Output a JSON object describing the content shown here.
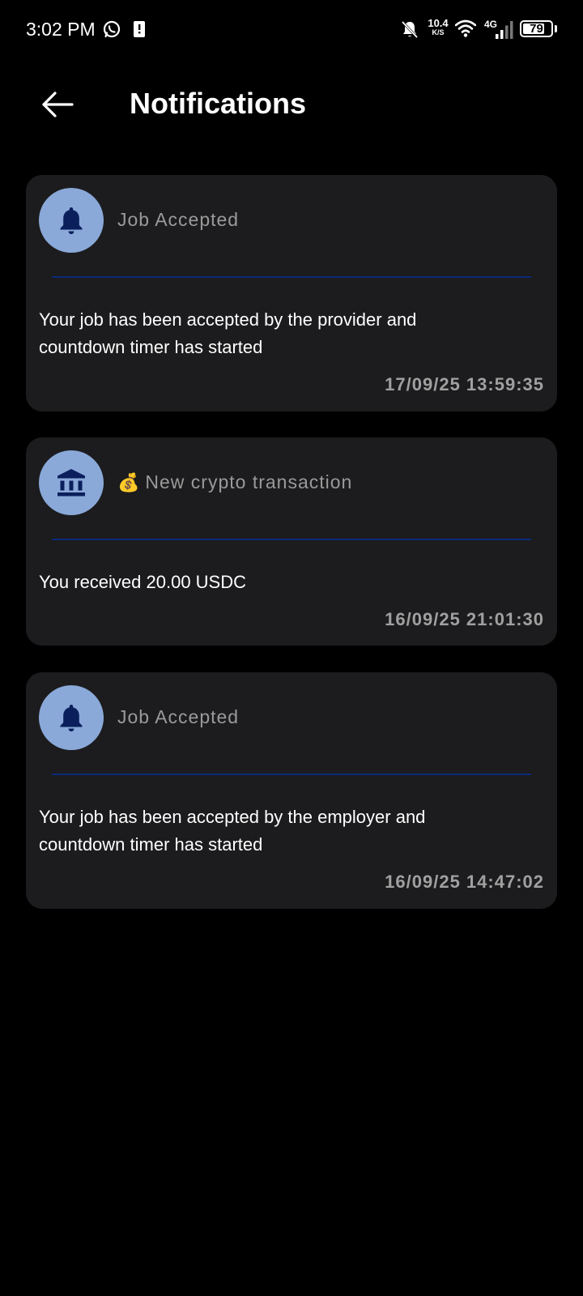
{
  "status_bar": {
    "time": "3:02 PM",
    "net_speed": "10.4",
    "net_speed_unit": "K/S",
    "network_type": "4G",
    "battery_level": "79",
    "icons": [
      "whatsapp-icon",
      "sim-alert-icon",
      "mute-bell-icon",
      "wifi-icon",
      "signal-icon",
      "battery-icon"
    ]
  },
  "app_bar": {
    "title": "Notifications",
    "back_icon": "arrow-left-icon"
  },
  "notifications": [
    {
      "icon": "bell-icon",
      "title": "Job Accepted",
      "body": "Your job has been accepted by the provider and countdown timer has started",
      "timestamp": "17/09/25 13:59:35"
    },
    {
      "icon": "bank-icon",
      "emoji": "💰",
      "title": "New crypto transaction",
      "body": "You received 20.00 USDC",
      "timestamp": "16/09/25 21:01:30"
    },
    {
      "icon": "bell-icon",
      "title": "Job Accepted",
      "body": "Your job has been accepted by the employer and countdown timer has started",
      "timestamp": "16/09/25 14:47:02"
    }
  ],
  "colors": {
    "background": "#000000",
    "card": "#1c1c1e",
    "avatar": "#8aa9d9",
    "icon_dark": "#0a1f5c",
    "divider": "#0b2a7a",
    "muted_text": "#9a9a9a"
  }
}
